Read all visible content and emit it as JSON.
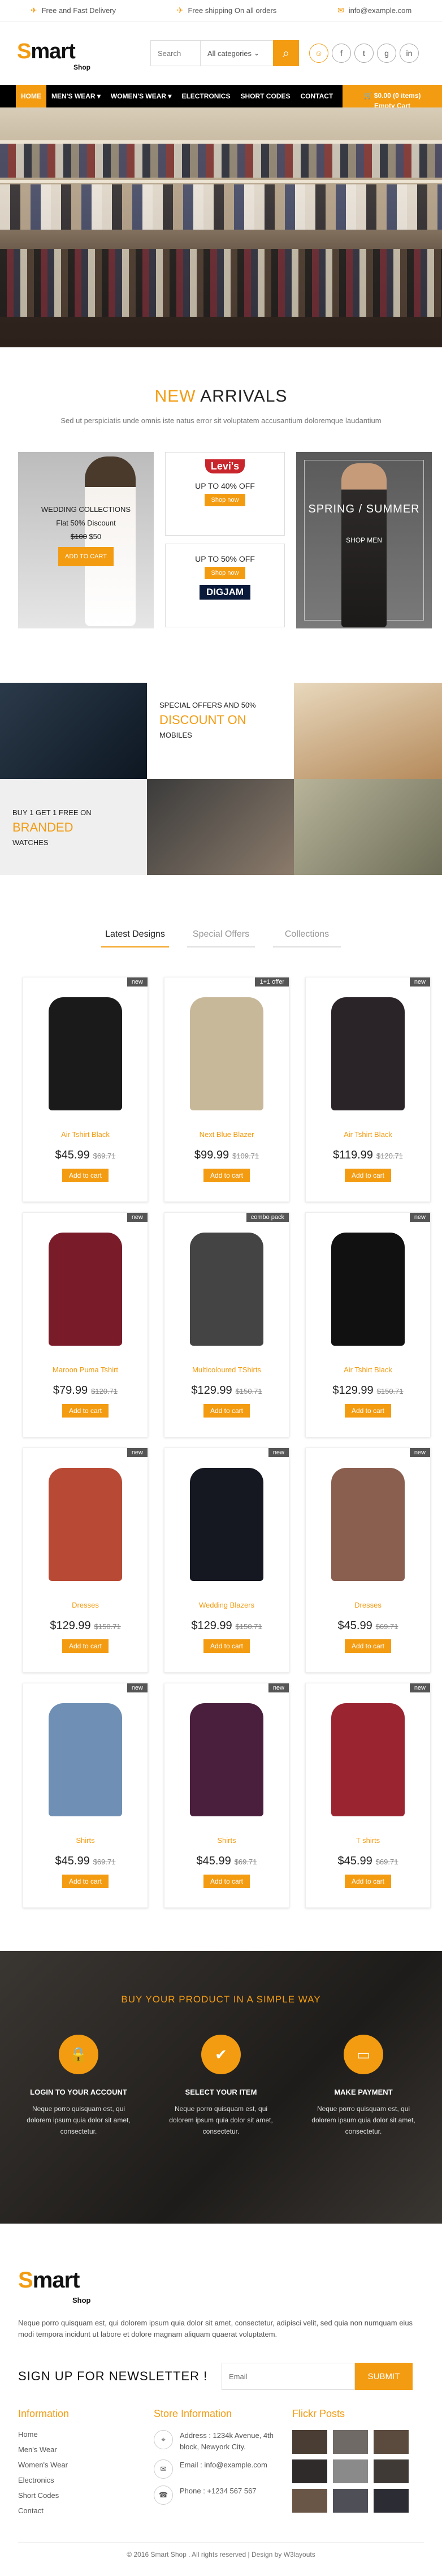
{
  "topbar": {
    "free_delivery": "Free and Fast Delivery",
    "free_shipping": "Free shipping On all orders",
    "email": "info@example.com"
  },
  "header": {
    "logo_main": "mart",
    "logo_s": "S",
    "logo_sub": "Shop",
    "search_placeholder": "Search",
    "category_value": "All categories",
    "social_icons": [
      "user-icon",
      "facebook-icon",
      "twitter-icon",
      "google-plus-icon",
      "linkedin-icon"
    ]
  },
  "nav": {
    "items": [
      "HOME",
      "MEN'S WEAR ▾",
      "WOMEN'S WEAR ▾",
      "ELECTRONICS",
      "SHORT CODES",
      "CONTACT"
    ],
    "cart_line1": "$0.00 (0 items)",
    "cart_line2": "Empty Cart"
  },
  "arrivals": {
    "title_accent": "NEW",
    "title_rest": " ARRIVALS",
    "subtitle": "Sed ut perspiciatis unde omnis iste natus error sit voluptatem accusantium doloremque laudantium",
    "wedding": {
      "title": "WEDDING COLLECTIONS",
      "line2": "Flat 50% Discount",
      "old_price": "$100",
      "new_price": "$50",
      "button": "ADD TO CART"
    },
    "levis": {
      "brand": "Levi's",
      "offer": "UP TO 40% OFF",
      "button": "Shop now"
    },
    "digjam": {
      "offer": "UP TO 50% OFF",
      "button": "Shop now",
      "brand": "DIGJAM"
    },
    "spring": {
      "title": "SPRING / SUMMER",
      "sub": "SHOP MEN"
    }
  },
  "offers": {
    "special_line1": "SPECIAL OFFERS AND 50%",
    "special_big": "DISCOUNT ON",
    "special_line2": "MOBILES",
    "buy_line1": "BUY 1 GET 1 FREE ON",
    "buy_big": "BRANDED",
    "buy_line2": "WATCHES"
  },
  "tabs": [
    "Latest Designs",
    "Special Offers",
    "Collections"
  ],
  "products": [
    {
      "name": "Air Tshirt Black",
      "price": "$45.99",
      "old": "$69.71",
      "tag": "new",
      "button": "Add to cart"
    },
    {
      "name": "Next Blue Blazer",
      "price": "$99.99",
      "old": "$109.71",
      "tag": "1+1 offer",
      "button": "Add to cart"
    },
    {
      "name": "Air Tshirt Black",
      "price": "$119.99",
      "old": "$120.71",
      "tag": "new",
      "button": "Add to cart"
    },
    {
      "name": "Maroon Puma Tshirt",
      "price": "$79.99",
      "old": "$120.71",
      "tag": "new",
      "button": "Add to cart"
    },
    {
      "name": "Multicoloured TShirts",
      "price": "$129.99",
      "old": "$150.71",
      "tag": "combo pack",
      "button": "Add to cart"
    },
    {
      "name": "Air Tshirt Black",
      "price": "$129.99",
      "old": "$150.71",
      "tag": "new",
      "button": "Add to cart"
    },
    {
      "name": "Dresses",
      "price": "$129.99",
      "old": "$150.71",
      "tag": "new",
      "button": "Add to cart"
    },
    {
      "name": "Wedding Blazers",
      "price": "$129.99",
      "old": "$150.71",
      "tag": "new",
      "button": "Add to cart"
    },
    {
      "name": "Dresses",
      "price": "$45.99",
      "old": "$69.71",
      "tag": "new",
      "button": "Add to cart"
    },
    {
      "name": "Shirts",
      "price": "$45.99",
      "old": "$69.71",
      "tag": "new",
      "button": "Add to cart"
    },
    {
      "name": "Shirts",
      "price": "$45.99",
      "old": "$69.71",
      "tag": "new",
      "button": "Add to cart"
    },
    {
      "name": "T shirts",
      "price": "$45.99",
      "old": "$69.71",
      "tag": "new",
      "button": "Add to cart"
    }
  ],
  "product_colors": [
    "#1a1a1a",
    "#c8b89a",
    "#2a2428",
    "#7a1b2a",
    "#444444",
    "#111111",
    "#b84a35",
    "#151820",
    "#8a5f50",
    "#6f8fb5",
    "#4a1f3d",
    "#9a2430"
  ],
  "buy_section": {
    "title": "BUY YOUR PRODUCT IN A SIMPLE WAY",
    "steps": [
      {
        "icon": "lock-icon",
        "glyph": "🔒",
        "title": "LOGIN TO YOUR ACCOUNT",
        "desc": "Neque porro quisquam est, qui dolorem ipsum quia dolor sit amet, consectetur."
      },
      {
        "icon": "check-icon",
        "glyph": "✔",
        "title": "SELECT YOUR ITEM",
        "desc": "Neque porro quisquam est, qui dolorem ipsum quia dolor sit amet, consectetur."
      },
      {
        "icon": "credit-card-icon",
        "glyph": "▭",
        "title": "MAKE PAYMENT",
        "desc": "Neque porro quisquam est, qui dolorem ipsum quia dolor sit amet, consectetur."
      }
    ]
  },
  "footer": {
    "desc": "Neque porro quisquam est, qui dolorem ipsum quia dolor sit amet, consectetur, adipisci velit, sed quia non numquam eius modi tempora incidunt ut labore et dolore magnam aliquam quaerat voluptatem.",
    "newsletter_label": "SIGN UP FOR NEWSLETTER !",
    "email_placeholder": "Email",
    "submit": "SUBMIT",
    "info_title": "Information",
    "info_links": [
      "Home",
      "Men's Wear",
      "Women's Wear",
      "Electronics",
      "Short Codes",
      "Contact"
    ],
    "store_title": "Store Information",
    "address": "Address : 1234k Avenue, 4th block, Newyork City.",
    "email_line": "Email : info@example.com",
    "phone": "Phone : +1234 567 567",
    "flickr_title": "Flickr Posts",
    "copyright": "© 2016 Smart Shop . All rights reserved | Design by W3layouts"
  },
  "flickr_colors": [
    "#4a3d33",
    "#706a66",
    "#5b4b3f",
    "#2f2b2a",
    "#8a8a8a",
    "#3f3a36",
    "#6a5647",
    "#4f4f58",
    "#2c2c34"
  ]
}
